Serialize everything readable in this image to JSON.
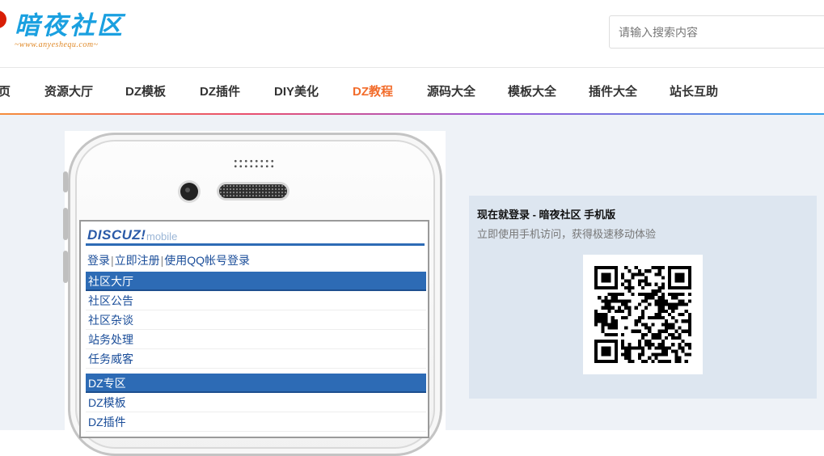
{
  "header": {
    "logo_text": "暗夜社区",
    "logo_sub": "~www.anyeshequ.com~",
    "search": {
      "placeholder": "请输入搜索内容",
      "value": ""
    }
  },
  "nav": {
    "items": [
      {
        "label": "页",
        "active": false
      },
      {
        "label": "资源大厅",
        "active": false
      },
      {
        "label": "DZ模板",
        "active": false
      },
      {
        "label": "DZ插件",
        "active": false
      },
      {
        "label": "DIY美化",
        "active": false
      },
      {
        "label": "DZ教程",
        "active": true
      },
      {
        "label": "源码大全",
        "active": false
      },
      {
        "label": "模板大全",
        "active": false
      },
      {
        "label": "插件大全",
        "active": false
      },
      {
        "label": "站长互助",
        "active": false
      }
    ],
    "active_color": "#f26c2b"
  },
  "phone": {
    "brand": "DISCUZ!",
    "brand_suffix": "mobile",
    "links": [
      "登录",
      "立即注册",
      "使用QQ帐号登录"
    ],
    "categories": [
      {
        "title": "社区大厅",
        "forums": [
          "社区公告",
          "社区杂谈",
          "站务处理",
          "任务威客"
        ]
      },
      {
        "title": "DZ专区",
        "forums": [
          "DZ模板",
          "DZ插件"
        ]
      }
    ]
  },
  "login": {
    "title": "现在就登录 - 暗夜社区 手机版",
    "subtitle": "立即使用手机访问，获得极速移动体验",
    "qr_icon": "qr-code-icon"
  },
  "colors": {
    "brand_blue": "#1aa0e0",
    "discuz_blue": "#2d6bb5",
    "panel_bg": "#dde6f0",
    "page_bg": "#eef2f7"
  }
}
